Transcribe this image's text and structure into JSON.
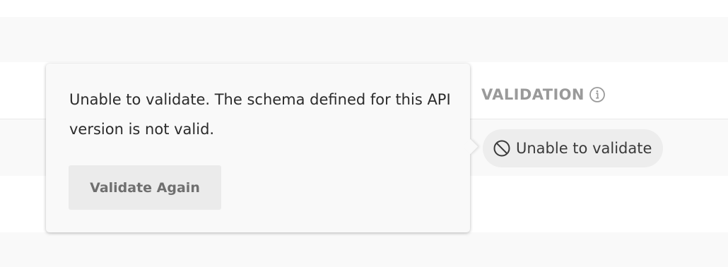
{
  "table": {
    "validation_header": "VALIDATION",
    "header_icon": "info-icon",
    "status": {
      "label": "Unable to validate",
      "icon": "ban-icon"
    }
  },
  "popover": {
    "message": "Unable to validate. The schema defined for this API version is not valid.",
    "button_label": "Validate Again"
  },
  "colors": {
    "header_text": "#9a9a9a",
    "pill_background": "#ededed",
    "popover_background": "#f9f9f9",
    "button_background": "#ebebeb"
  }
}
